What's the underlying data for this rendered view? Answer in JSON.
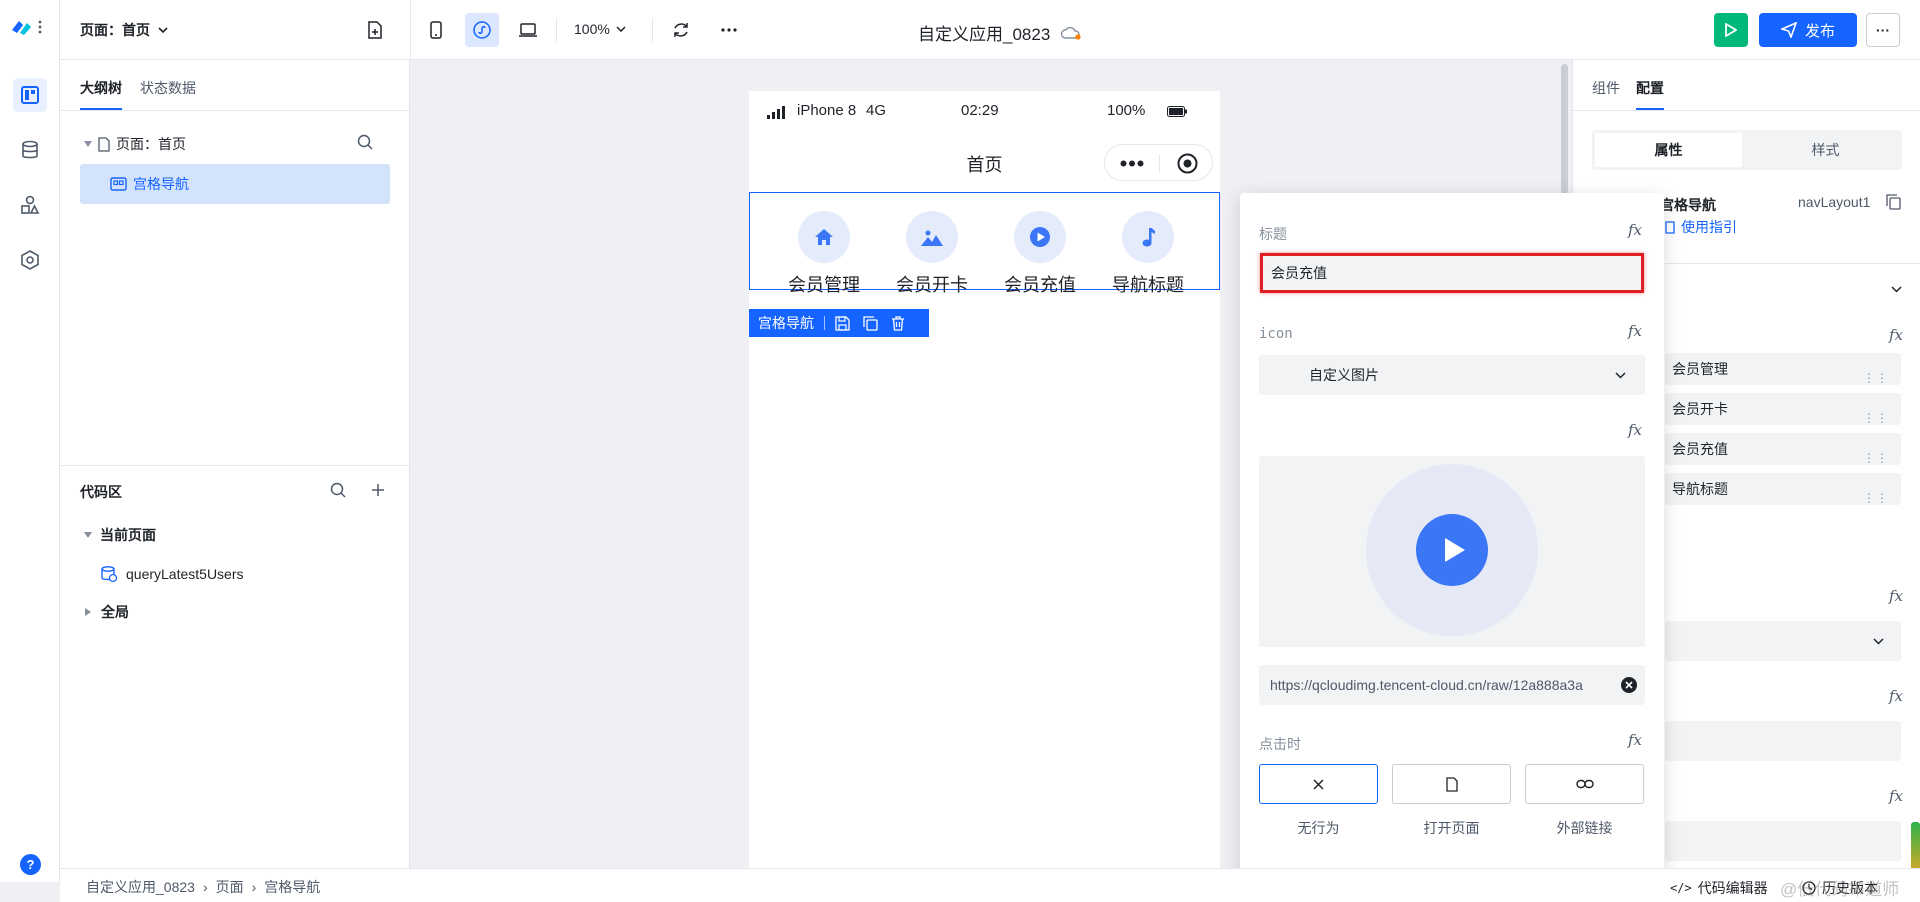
{
  "topbar": {
    "page_selector": "页面：首页",
    "zoom": "100%",
    "app_title": "自定义应用_0823",
    "publish_label": "发布",
    "more_label": "···"
  },
  "left": {
    "tabs": [
      "大纲树",
      "状态数据"
    ],
    "tree_root": "页面：首页",
    "tree_child": "宫格导航",
    "code_title": "代码区",
    "current_page": "当前页面",
    "query_name": "queryLatest5Users",
    "global": "全局"
  },
  "phone": {
    "carrier": "iPhone 8",
    "network": "4G",
    "time": "02:29",
    "battery": "100%",
    "page_title": "首页",
    "grid_items": [
      "会员管理",
      "会员开卡",
      "会员充值",
      "导航标题"
    ],
    "selection_tag": "宫格导航"
  },
  "popover": {
    "title_label": "标题",
    "title_value": "会员充值",
    "icon_label": "icon",
    "icon_select": "自定义图片",
    "url_value": "https://qcloudimg.tencent-cloud.cn/raw/12a888a3a",
    "click_label": "点击时",
    "actions": [
      "无行为",
      "打开页面",
      "外部链接"
    ],
    "fx": "fx"
  },
  "right": {
    "tabs": [
      "组件",
      "配置"
    ],
    "seg": [
      "属性",
      "样式"
    ],
    "component_name": "宫格导航",
    "component_id": "navLayout1",
    "guide": "使用指引",
    "items": [
      "会员管理",
      "会员开卡",
      "会员充值",
      "导航标题"
    ]
  },
  "status": {
    "crumbs": [
      "自定义应用_0823",
      "页面",
      "宫格导航"
    ],
    "code_editor": "代码编辑器",
    "history": "历史版本",
    "watermark": "@低代码布道师"
  },
  "colors": {
    "primary": "#1664ff",
    "run_green": "#00b87a",
    "highlight_red": "#e02020"
  }
}
